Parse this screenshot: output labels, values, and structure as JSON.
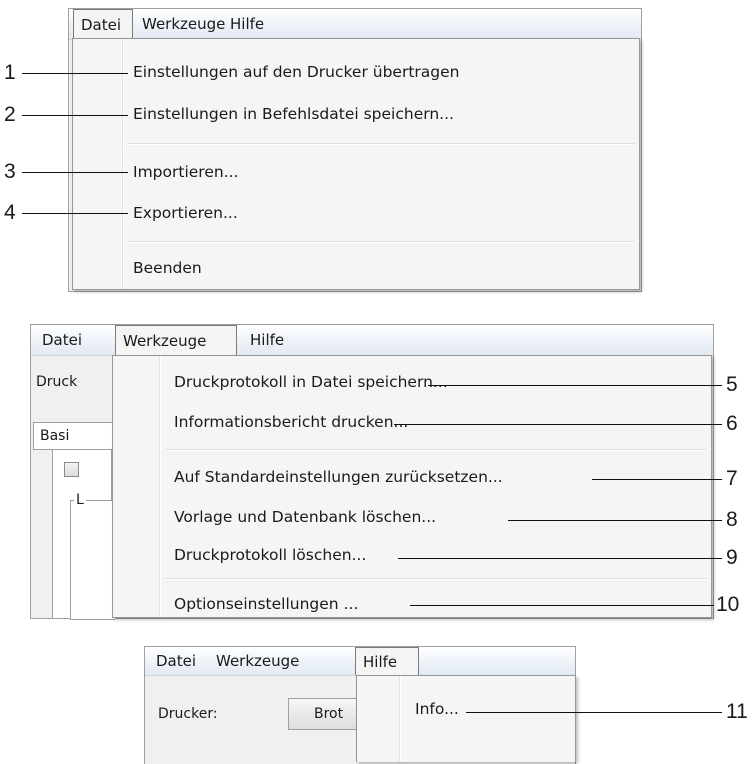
{
  "shot1": {
    "menubar": [
      "Datei",
      "Werkzeuge",
      "Hilfe"
    ],
    "items": [
      "Einstellungen auf den Drucker übertragen",
      "Einstellungen in Befehlsdatei speichern...",
      "Importieren...",
      "Exportieren...",
      "Beenden"
    ],
    "callouts": [
      "1",
      "2",
      "3",
      "4"
    ]
  },
  "shot2": {
    "menubar": [
      "Datei",
      "Werkzeuge",
      "Hilfe"
    ],
    "background": {
      "drucker_label": "Druck",
      "tab_label": "Basi",
      "group_label": "L"
    },
    "items": [
      "Druckprotokoll in Datei speichern...",
      "Informationsbericht drucken...",
      "Auf Standardeinstellungen zurücksetzen...",
      "Vorlage und Datenbank löschen...",
      "Druckprotokoll löschen...",
      "Optionseinstellungen ..."
    ],
    "callouts": [
      "5",
      "6",
      "7",
      "8",
      "9",
      "10"
    ]
  },
  "shot3": {
    "menubar": [
      "Datei",
      "Werkzeuge",
      "Hilfe"
    ],
    "background": {
      "drucker_label": "Drucker:",
      "combo_value": "Brot"
    },
    "items": [
      "Info..."
    ],
    "callouts": [
      "11"
    ]
  }
}
